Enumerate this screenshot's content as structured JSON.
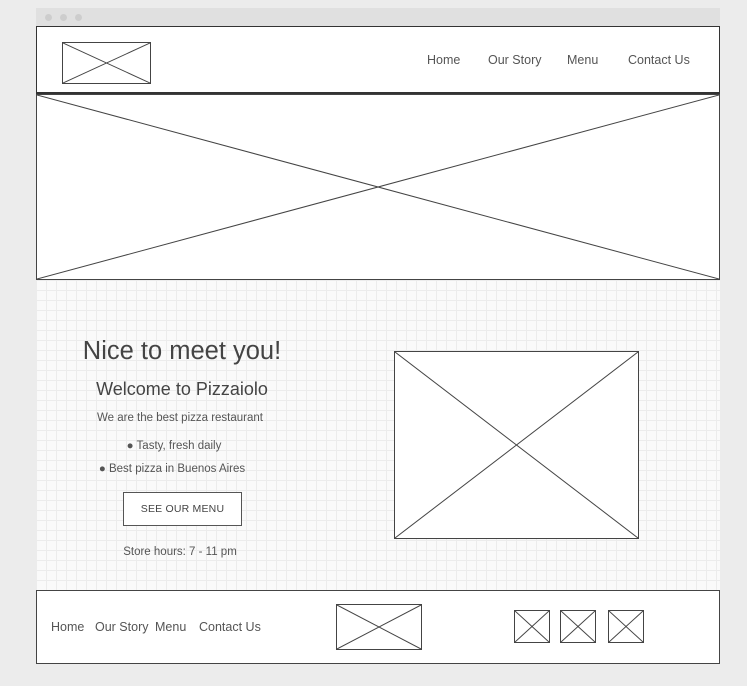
{
  "header": {
    "nav": [
      {
        "label": "Home"
      },
      {
        "label": "Our Story"
      },
      {
        "label": "Menu"
      },
      {
        "label": "Contact Us"
      }
    ]
  },
  "main": {
    "heading": "Nice to meet you!",
    "subheading": "Welcome to Pizzaiolo",
    "tagline": "We are the best pizza restaurant",
    "bullets": [
      "● Tasty, fresh daily",
      "● Best pizza in Buenos Aires"
    ],
    "cta_label": "SEE OUR MENU",
    "store_hours": "Store hours: 7 - 11 pm"
  },
  "footer": {
    "nav": [
      {
        "label": "Home"
      },
      {
        "label": "Our Story"
      },
      {
        "label": "Menu"
      },
      {
        "label": "Contact Us"
      }
    ],
    "social_icons": [
      "social-icon-1",
      "social-icon-2",
      "social-icon-3"
    ]
  },
  "colors": {
    "border": "#444444",
    "text": "#555555",
    "page_background": "#ececec"
  }
}
